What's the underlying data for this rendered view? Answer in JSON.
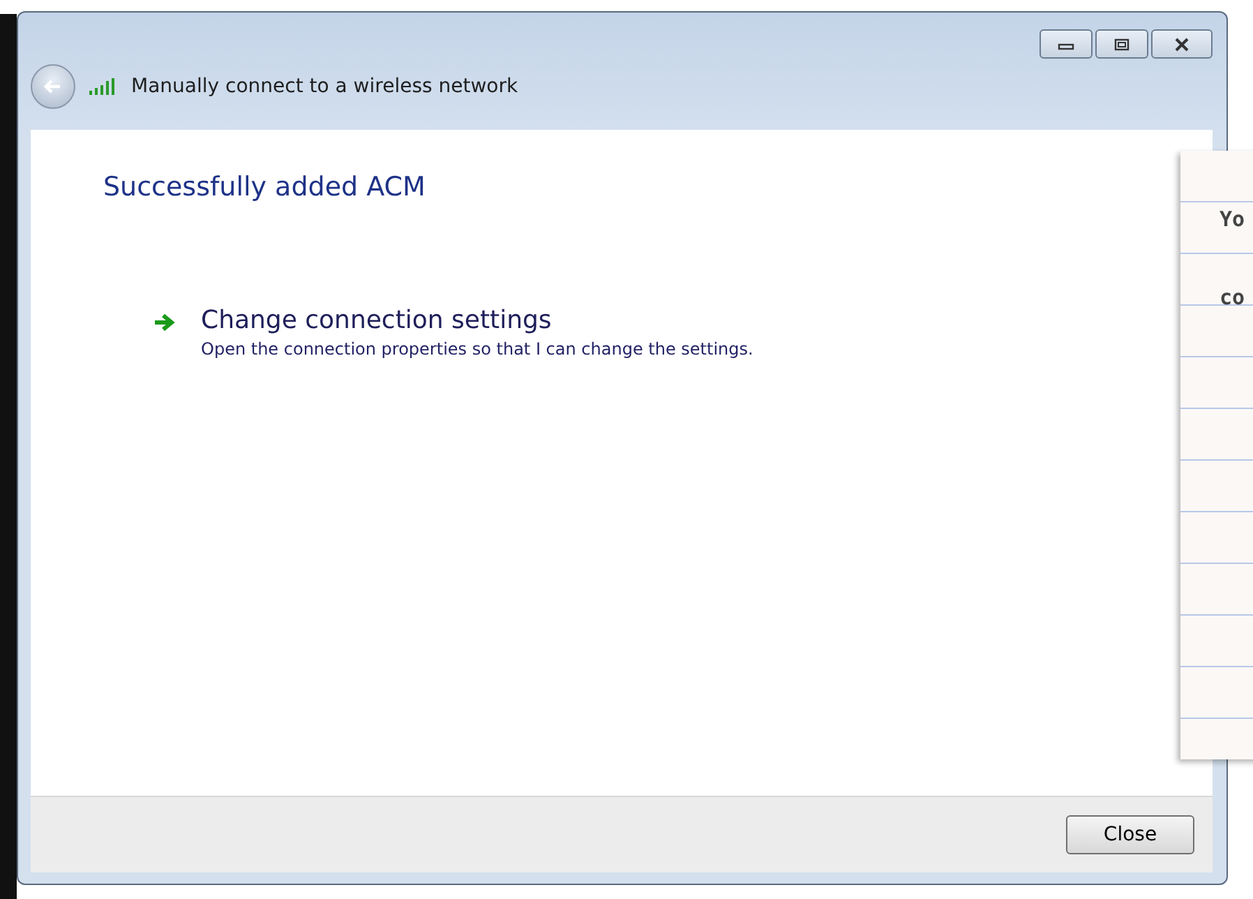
{
  "window": {
    "title": "Manually connect to a wireless network"
  },
  "heading": "Successfully added ACM",
  "tasks": [
    {
      "title": "Change connection settings",
      "description": "Open the connection properties so that I can change the settings."
    }
  ],
  "buttons": [
    "Close"
  ],
  "note": {
    "lines": [
      "Yo",
      "co"
    ]
  }
}
